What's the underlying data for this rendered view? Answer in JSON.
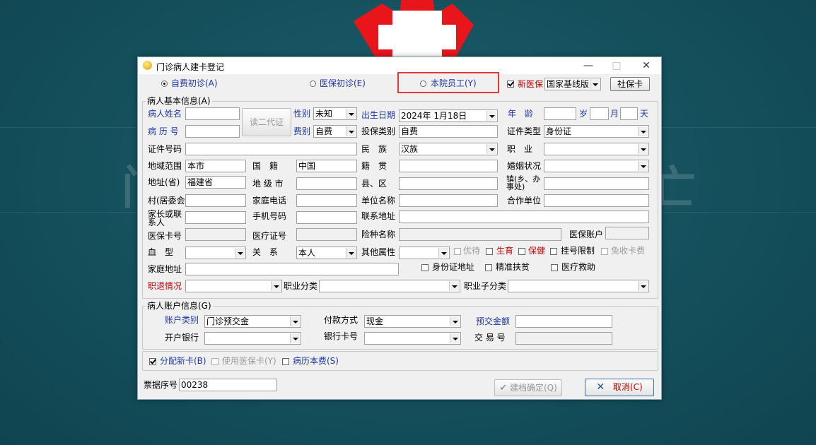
{
  "dialog": {
    "title": "门诊病人建卡登记",
    "minimize": "—",
    "maximize": "□",
    "close": "✕"
  },
  "mode": {
    "self_pay": "自费初诊(A)",
    "insurance": "医保初诊(E)",
    "staff": "本院员工(Y)",
    "new_insurance_label": "新医保",
    "insurance_version": "国家基线版",
    "social_card_btn": "社保卡"
  },
  "basic": {
    "group_title": "病人基本信息(A)",
    "name_label": "病人姓名",
    "read_id_btn": "读二代证",
    "gender_label": "性别",
    "gender_value": "未知",
    "birth_label": "出生日期",
    "birth_value": "2024年 1月18日",
    "age_label": "年　龄",
    "age_year": "岁",
    "age_month": "月",
    "age_day": "天",
    "record_label": "病 历 号",
    "fee_label": "费别",
    "fee_value": "自费",
    "insure_type_label": "投保类别",
    "insure_type_value": "自费",
    "cert_type_label": "证件类型",
    "cert_type_value": "身份证",
    "cert_no_label": "证件号码",
    "nation_label": "民　族",
    "nation_value": "汉族",
    "job_label": "职　业",
    "region_label": "地域范围",
    "region_value": "本市",
    "country_label": "国　籍",
    "country_value": "中国",
    "native_label": "籍　贯",
    "marital_label": "婚姻状况",
    "province_label": "地址(省)",
    "province_value": "福建省",
    "city_label": "地 级 市",
    "county_label": "县、区",
    "town_label": "镇(乡、办事处)",
    "village_label": "村(居委会",
    "home_phone_label": "家庭电话",
    "employer_label": "单位名称",
    "partner_label": "合作单位",
    "guardian_label": "家长或联系人",
    "mobile_label": "手机号码",
    "contact_addr_label": "联系地址",
    "ins_card_label": "医保卡号",
    "med_cert_label": "医疗证号",
    "insurance_name_label": "险种名称",
    "ins_account_label": "医保账户",
    "blood_label": "血　型",
    "relation_label": "关　系",
    "relation_value": "本人",
    "other_attr_label": "其他属性",
    "priority_label": "优待",
    "birth_ins_label": "生育",
    "health_label": "保健",
    "reg_limit_label": "挂号限制",
    "free_card_label": "免收卡费",
    "home_addr_label": "家庭地址",
    "id_addr_label": "身份证地址",
    "poverty_label": "精准扶贫",
    "med_aid_label": "医疗救助",
    "retire_label": "职退情况",
    "job_category_label": "职业分类",
    "job_sub_label": "职业子分类"
  },
  "account": {
    "group_title": "病人账户信息(G)",
    "acct_type_label": "账户类别",
    "acct_type_value": "门诊预交金",
    "pay_method_label": "付款方式",
    "pay_method_value": "现金",
    "deposit_label": "预交金额",
    "bank_label": "开户银行",
    "bank_card_label": "银行卡号",
    "trade_no_label": "交 易 号"
  },
  "options": {
    "assign_card": "分配新卡(B)",
    "use_ins_card": "使用医保卡(Y)",
    "record_fee": "病历本费(S)"
  },
  "footer": {
    "ticket_label": "票据序号",
    "ticket_value": "00238",
    "confirm_btn": "建档确定(Q)",
    "cancel_btn": "取消(C)"
  }
}
